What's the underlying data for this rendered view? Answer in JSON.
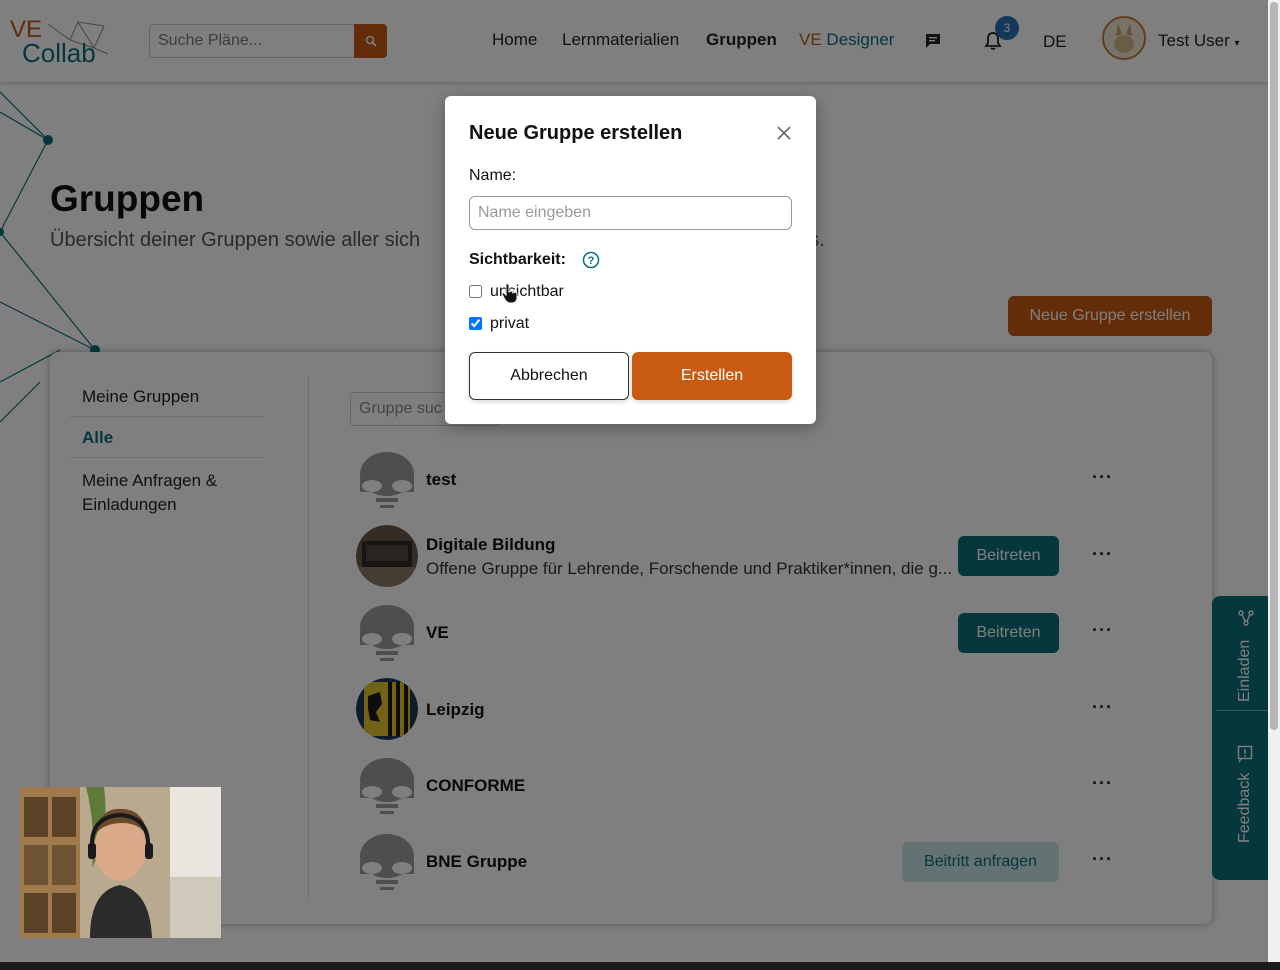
{
  "nav": {
    "logo_ve": "VE",
    "logo_collab": "Collab",
    "search_placeholder": "Suche Pläne...",
    "links": {
      "home": "Home",
      "materials": "Lernmaterialien",
      "groups": "Gruppen"
    },
    "designer_ve": "VE",
    "designer_label": "Designer",
    "notification_count": "3",
    "language": "DE",
    "user_name": "Test User"
  },
  "page": {
    "title": "Gruppen",
    "subtitle_left": "Übersicht deiner Gruppen sowie aller sich",
    "subtitle_right": "kes.",
    "new_group_button": "Neue Gruppe erstellen"
  },
  "sidebar": {
    "items": [
      {
        "label": "Meine Gruppen"
      },
      {
        "label": "Alle"
      },
      {
        "label": "Meine Anfragen &"
      },
      {
        "label": "Einladungen"
      }
    ]
  },
  "groups": {
    "search_placeholder": "Gruppe suc",
    "list": [
      {
        "name": "test",
        "desc": "",
        "action": ""
      },
      {
        "name": "Digitale Bildung",
        "desc": "Offene Gruppe für Lehrende, Forschende und Praktiker*innen, die g...",
        "action": "Beitreten"
      },
      {
        "name": "VE",
        "desc": "",
        "action": "Beitreten"
      },
      {
        "name": "Leipzig",
        "desc": "",
        "action": ""
      },
      {
        "name": "CONFORME",
        "desc": "",
        "action": ""
      },
      {
        "name": "BNE Gruppe",
        "desc": "",
        "action": "Beitritt anfragen"
      }
    ],
    "more_label": "···"
  },
  "side_tabs": {
    "invite": "Einladen",
    "feedback": "Feedback"
  },
  "modal": {
    "title": "Neue Gruppe erstellen",
    "name_label": "Name:",
    "name_placeholder": "Name eingeben",
    "visibility_label": "Sichtbarkeit:",
    "option_invisible": "unsichtbar",
    "option_private": "privat",
    "invisible_checked": false,
    "private_checked": true,
    "cancel": "Abbrechen",
    "create": "Erstellen"
  },
  "colors": {
    "brand_orange": "#c85a12",
    "brand_teal": "#0b6e7a",
    "badge_blue": "#2a6fb3"
  }
}
